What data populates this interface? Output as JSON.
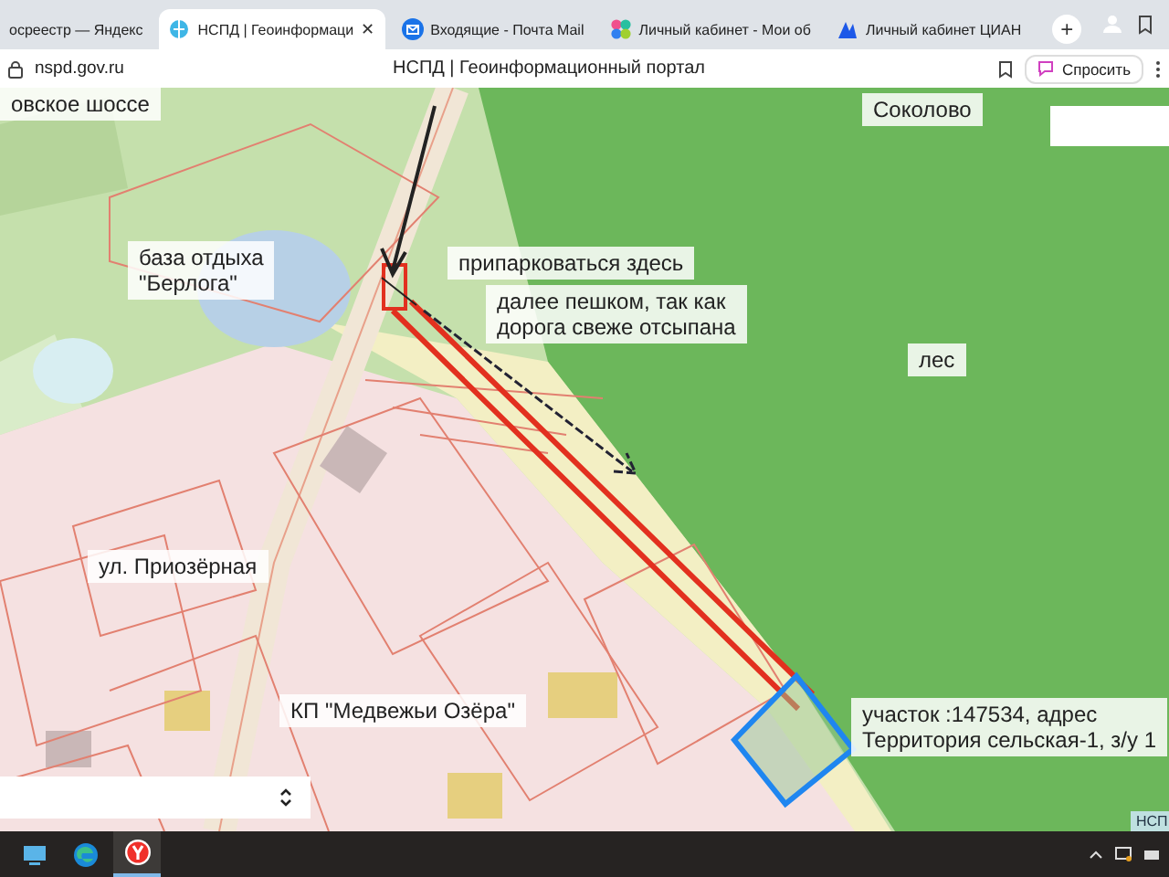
{
  "tabs": [
    {
      "label": "осреестр — Яндекс",
      "kind": "plain",
      "selected": false
    },
    {
      "label": "НСПД | Геоинформаци",
      "kind": "portal",
      "selected": true,
      "close": "✕"
    },
    {
      "label": "Входящие - Почта Mail",
      "kind": "mail",
      "selected": false
    },
    {
      "label": "Личный кабинет - Мои об",
      "kind": "cabinet",
      "selected": false
    },
    {
      "label": "Личный кабинет ЦИАН",
      "kind": "realty",
      "selected": false
    }
  ],
  "new_tab": "+",
  "address_bar": {
    "url": "nspd.gov.ru",
    "page_title": "НСПД | Геоинформационный портал",
    "ask_button": "Спросить"
  },
  "map": {
    "labels": [
      {
        "text": "овское шоссе",
        "kind": "box"
      },
      {
        "text": "Соколово",
        "kind": "box"
      },
      {
        "text": "база отдыха\n\"Берлога\"",
        "kind": "box"
      },
      {
        "text": "припарковаться здесь",
        "kind": "box"
      },
      {
        "text": "далее пешком, так как\nдорога свеже отсыпана",
        "kind": "box"
      },
      {
        "text": "лес",
        "kind": "box"
      },
      {
        "text": "ул. Приозёрная",
        "kind": "box"
      },
      {
        "text": "КП \"Медвежьи Озёра\"",
        "kind": "box"
      },
      {
        "text": "участок :147534, адрес\nТерритория сельская-1, з/у 1",
        "kind": "box"
      },
      {
        "text": "НСП",
        "kind": "tag"
      }
    ]
  },
  "taskbar": [
    {
      "kind": "explorer",
      "active": false
    },
    {
      "kind": "edge",
      "active": false
    },
    {
      "kind": "yandex",
      "active": true
    }
  ]
}
